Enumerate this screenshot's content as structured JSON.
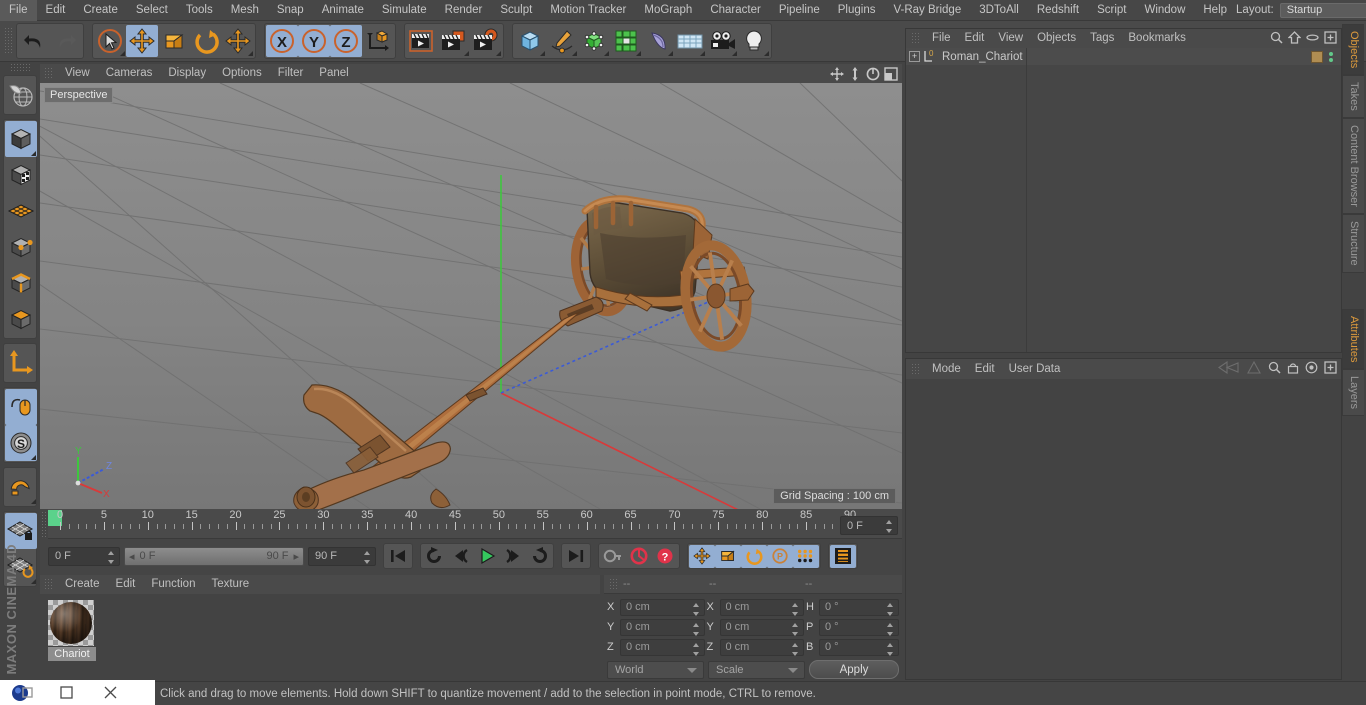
{
  "app": {
    "brand": "MAXON CINEMA 4D"
  },
  "menubar": {
    "items": [
      "File",
      "Edit",
      "Create",
      "Select",
      "Tools",
      "Mesh",
      "Snap",
      "Animate",
      "Simulate",
      "Render",
      "Sculpt",
      "Motion Tracker",
      "MoGraph",
      "Character",
      "Pipeline",
      "Plugins",
      "V-Ray Bridge",
      "3DToAll",
      "Redshift",
      "Script",
      "Window",
      "Help"
    ],
    "layout_label": "Layout:",
    "layout_value": "Startup",
    "search_icon": "search-icon"
  },
  "toolbar": {
    "groups": [
      {
        "name": "history",
        "buttons": [
          {
            "name": "undo-button",
            "icon": "undo-arrow-icon",
            "selected": false,
            "disabled": false
          },
          {
            "name": "redo-button",
            "icon": "redo-arrow-icon",
            "selected": false,
            "disabled": true
          }
        ]
      },
      {
        "name": "transform-tools",
        "buttons": [
          {
            "name": "live-selection-tool",
            "icon": "cursor-circle-icon",
            "selected": false,
            "disabled": false
          },
          {
            "name": "move-tool",
            "icon": "move-arrows-icon",
            "selected": true,
            "disabled": false
          },
          {
            "name": "scale-tool",
            "icon": "scale-box-icon",
            "selected": false,
            "disabled": false
          },
          {
            "name": "rotate-tool",
            "icon": "rotate-circle-icon",
            "selected": false,
            "disabled": false
          },
          {
            "name": "move-alt-tool",
            "icon": "move-arrows-icon",
            "selected": false,
            "disabled": false
          }
        ]
      },
      {
        "name": "axis-locks",
        "buttons": [
          {
            "name": "lock-x-axis",
            "icon": "x-axis-icon",
            "selected": true,
            "disabled": false
          },
          {
            "name": "lock-y-axis",
            "icon": "y-axis-icon",
            "selected": true,
            "disabled": false
          },
          {
            "name": "lock-z-axis",
            "icon": "z-axis-icon",
            "selected": true,
            "disabled": false
          },
          {
            "name": "world-object-coord-toggle",
            "icon": "world-axis-cube-icon",
            "selected": false,
            "disabled": false
          }
        ]
      },
      {
        "name": "render-tools",
        "buttons": [
          {
            "name": "render-view-button",
            "icon": "clapperboard-view-icon",
            "selected": false,
            "disabled": false
          },
          {
            "name": "render-to-picture-viewer-button",
            "icon": "clapperboard-picture-icon",
            "selected": false,
            "disabled": false
          },
          {
            "name": "render-settings-button",
            "icon": "clapperboard-gear-icon",
            "selected": false,
            "disabled": false
          }
        ]
      },
      {
        "name": "create-objects",
        "buttons": [
          {
            "name": "add-primitive-cube-button",
            "icon": "blue-cube-icon",
            "selected": false,
            "disabled": false
          },
          {
            "name": "add-spline-button",
            "icon": "pen-spline-icon",
            "selected": false,
            "disabled": false
          },
          {
            "name": "add-generator-button",
            "icon": "green-cube-icon",
            "selected": false,
            "disabled": false
          },
          {
            "name": "add-array-button",
            "icon": "green-cluster-icon",
            "selected": false,
            "disabled": false
          },
          {
            "name": "add-deformer-button",
            "icon": "bend-deformer-icon",
            "selected": false,
            "disabled": false
          },
          {
            "name": "add-scene-object-button",
            "icon": "floor-grid-icon",
            "selected": false,
            "disabled": false
          },
          {
            "name": "add-camera-button",
            "icon": "camera-icon",
            "selected": false,
            "disabled": false
          },
          {
            "name": "add-light-button",
            "icon": "light-bulb-icon",
            "selected": false,
            "disabled": false
          }
        ]
      }
    ]
  },
  "leftbar": {
    "groups": [
      {
        "buttons": [
          {
            "name": "make-editable-button",
            "icon": "globe-mesh-icon",
            "selected": false
          }
        ]
      },
      {
        "buttons": [
          {
            "name": "model-mode-button",
            "icon": "grey-cube-icon",
            "selected": true
          },
          {
            "name": "texture-mode-button",
            "icon": "checker-cube-icon",
            "selected": false
          },
          {
            "name": "uv-mesh-mode-button",
            "icon": "orange-grid-icon",
            "selected": false
          },
          {
            "name": "points-mode-button",
            "icon": "points-cube-icon",
            "selected": false
          },
          {
            "name": "edges-mode-button",
            "icon": "edges-cube-icon",
            "selected": false
          },
          {
            "name": "polygons-mode-button",
            "icon": "polygons-cube-icon",
            "selected": false
          }
        ]
      },
      {
        "buttons": [
          {
            "name": "axis-modify-button",
            "icon": "orange-axis-icon",
            "selected": false
          }
        ]
      },
      {
        "buttons": [
          {
            "name": "enable-axis-button",
            "icon": "mouse-axis-icon",
            "selected": true
          },
          {
            "name": "soft-selection-button",
            "icon": "s-sphere-icon",
            "selected": true
          }
        ]
      },
      {
        "buttons": [
          {
            "name": "snap-magnet-button",
            "icon": "magnet-icon",
            "selected": false
          }
        ]
      },
      {
        "buttons": [
          {
            "name": "workplane-lock-button",
            "icon": "plane-lock-icon",
            "selected": true
          },
          {
            "name": "workplane-rotate-button",
            "icon": "plane-rotate-icon",
            "selected": false
          }
        ]
      }
    ]
  },
  "viewport": {
    "menu": [
      "View",
      "Cameras",
      "Display",
      "Options",
      "Filter",
      "Panel"
    ],
    "camera_label": "Perspective",
    "grid_spacing": "Grid Spacing : 100 cm",
    "axis_labels": {
      "x": "X",
      "y": "Y",
      "z": "Z"
    },
    "corner_icons": [
      "pan-view-icon",
      "dolly-view-icon",
      "rotate-view-icon",
      "maximize-view-icon"
    ],
    "scene_object": "Roman chariot 3D model"
  },
  "timeline": {
    "ticks": [
      0,
      5,
      10,
      15,
      20,
      25,
      30,
      35,
      40,
      45,
      50,
      55,
      60,
      65,
      70,
      75,
      80,
      85,
      90
    ],
    "current_frame": "0 F",
    "range_start": "0 F",
    "range_end": "90 F",
    "preview_end": "90 F",
    "frame_field_right": "0 F",
    "playback_buttons": [
      {
        "name": "go-to-start-button",
        "icon": "skip-start-icon"
      },
      {
        "name": "play-backwards-loop-button",
        "icon": "loop-back-icon"
      },
      {
        "name": "step-back-button",
        "icon": "step-back-icon"
      },
      {
        "name": "play-button",
        "icon": "play-icon"
      },
      {
        "name": "step-forward-button",
        "icon": "step-forward-icon"
      },
      {
        "name": "play-forward-loop-button",
        "icon": "loop-forward-icon"
      },
      {
        "name": "go-to-end-button",
        "icon": "skip-end-icon"
      }
    ],
    "key_buttons": [
      {
        "name": "record-active-objects-button",
        "icon": "key-icon",
        "selected": false
      },
      {
        "name": "autokeying-button",
        "icon": "red-circle-icon",
        "selected": false
      },
      {
        "name": "keyframe-selection-button",
        "icon": "red-question-icon",
        "selected": false
      }
    ],
    "record_toggles": [
      {
        "name": "record-position-button",
        "icon": "move-arrows-icon",
        "selected": true
      },
      {
        "name": "record-scale-button",
        "icon": "scale-box-icon",
        "selected": true
      },
      {
        "name": "record-rotation-button",
        "icon": "rotate-circle-icon",
        "selected": true
      },
      {
        "name": "record-pla-button",
        "icon": "p-circle-icon",
        "selected": true
      },
      {
        "name": "record-parameter-button",
        "icon": "dots-grid-icon",
        "selected": true
      }
    ],
    "filmstrip_button": {
      "name": "keyframe-mode-button",
      "icon": "filmstrip-icon",
      "selected": true
    }
  },
  "materials": {
    "menu": [
      "Create",
      "Edit",
      "Function",
      "Texture"
    ],
    "items": [
      {
        "name": "Chariot"
      }
    ]
  },
  "coordinates": {
    "header_dashes": [
      "--",
      "--",
      "--"
    ],
    "rows": [
      {
        "pos_label": "X",
        "pos_value": "0 cm",
        "size_label": "X",
        "size_value": "0 cm",
        "rot_label": "H",
        "rot_value": "0 °"
      },
      {
        "pos_label": "Y",
        "pos_value": "0 cm",
        "size_label": "Y",
        "size_value": "0 cm",
        "rot_label": "P",
        "rot_value": "0 °"
      },
      {
        "pos_label": "Z",
        "pos_value": "0 cm",
        "size_label": "Z",
        "size_value": "0 cm",
        "rot_label": "B",
        "rot_value": "0 °"
      }
    ],
    "coord_system": "World",
    "size_mode": "Scale",
    "apply_label": "Apply"
  },
  "object_manager": {
    "menu": [
      "File",
      "Edit",
      "View",
      "Objects",
      "Tags",
      "Bookmarks"
    ],
    "icons": [
      "search-icon",
      "home-icon",
      "ellipse-icon",
      "plus-box-icon"
    ],
    "objects": [
      {
        "name": "Roman_Chariot",
        "layer_marker": "0"
      }
    ]
  },
  "attribute_manager": {
    "menu": [
      "Mode",
      "Edit",
      "User Data"
    ],
    "icons": [
      "arrow-left-icon",
      "arrow-right-icon",
      "search-icon",
      "lock-icon",
      "target-icon",
      "plus-box-icon"
    ]
  },
  "right_tabs": {
    "upper": [
      {
        "label": "Objects",
        "active": true
      },
      {
        "label": "Takes",
        "active": false
      },
      {
        "label": "Content Browser",
        "active": false
      },
      {
        "label": "Structure",
        "active": false
      }
    ],
    "lower": [
      {
        "label": "Attributes",
        "active": true
      },
      {
        "label": "Layers",
        "active": false
      }
    ]
  },
  "status": {
    "message": "Click and drag to move elements. Hold down SHIFT to quantize movement / add to the selection in point mode, CTRL to remove."
  },
  "colors": {
    "accent_orange": "#e08a28",
    "selection_blue": "#93aed2",
    "panel_bg": "#434343",
    "axis_x": "#d83a3a",
    "axis_y": "#3ec63e",
    "axis_z": "#3a5ad8"
  }
}
